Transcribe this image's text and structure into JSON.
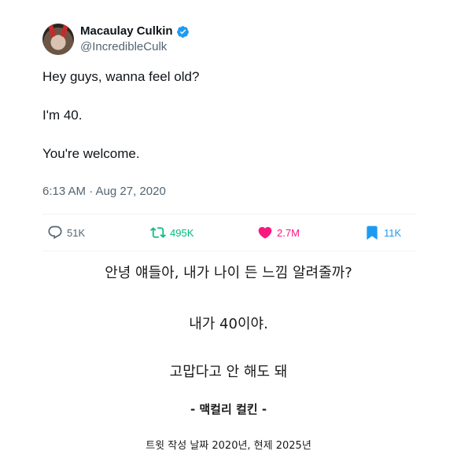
{
  "tweet": {
    "author": {
      "display_name": "Macaulay Culkin",
      "handle": "@IncredibleCulk",
      "verified": true
    },
    "body": [
      "Hey guys, wanna feel old?",
      "I'm 40.",
      "You're welcome."
    ],
    "timestamp": "6:13 AM · Aug 27, 2020",
    "stats": {
      "replies": "51K",
      "retweets": "495K",
      "likes": "2.7M",
      "bookmarks": "11K"
    },
    "colors": {
      "verified": "#1d9bf0",
      "retweet": "#00ba7c",
      "like": "#f91880",
      "bookmark": "#1d9bf0",
      "muted": "#536471"
    }
  },
  "translation": {
    "line1": "안녕 얘들아, 내가 나이 든 느낌 알려줄까?",
    "line2": "내가 40이야.",
    "line3": "고맙다고 안 해도 돼",
    "signature": "- 맥컬리 컬킨 -",
    "note": "트윗 작성 날짜 2020년, 현제 2025년"
  }
}
